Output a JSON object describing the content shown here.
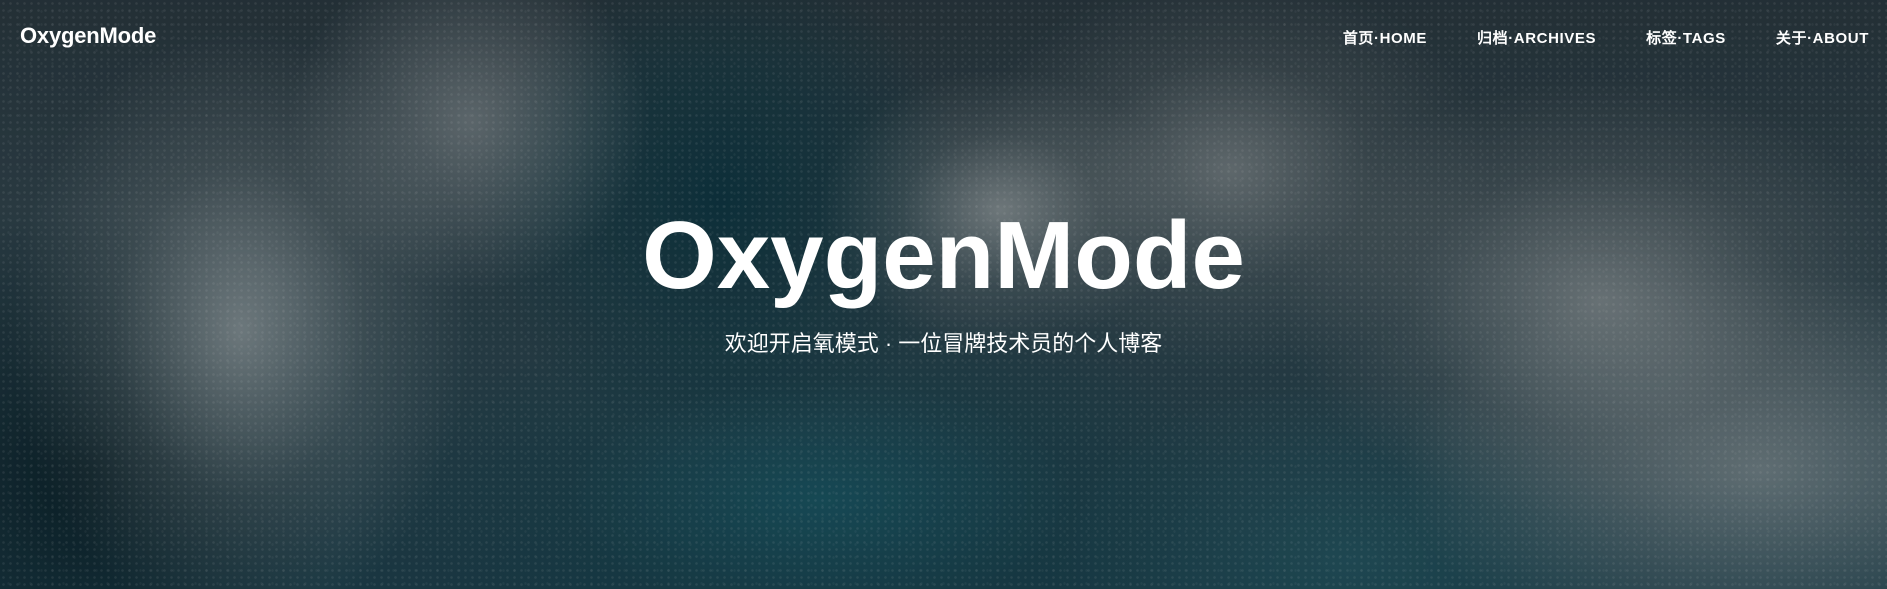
{
  "navbar": {
    "brand": "OxygenMode",
    "links": [
      {
        "label": "首页·HOME"
      },
      {
        "label": "归档·ARCHIVES"
      },
      {
        "label": "标签·TAGS"
      },
      {
        "label": "关于·ABOUT"
      }
    ]
  },
  "hero": {
    "title": "OxygenMode",
    "subtitle": "欢迎开启氧模式 · 一位冒牌技术员的个人博客"
  }
}
